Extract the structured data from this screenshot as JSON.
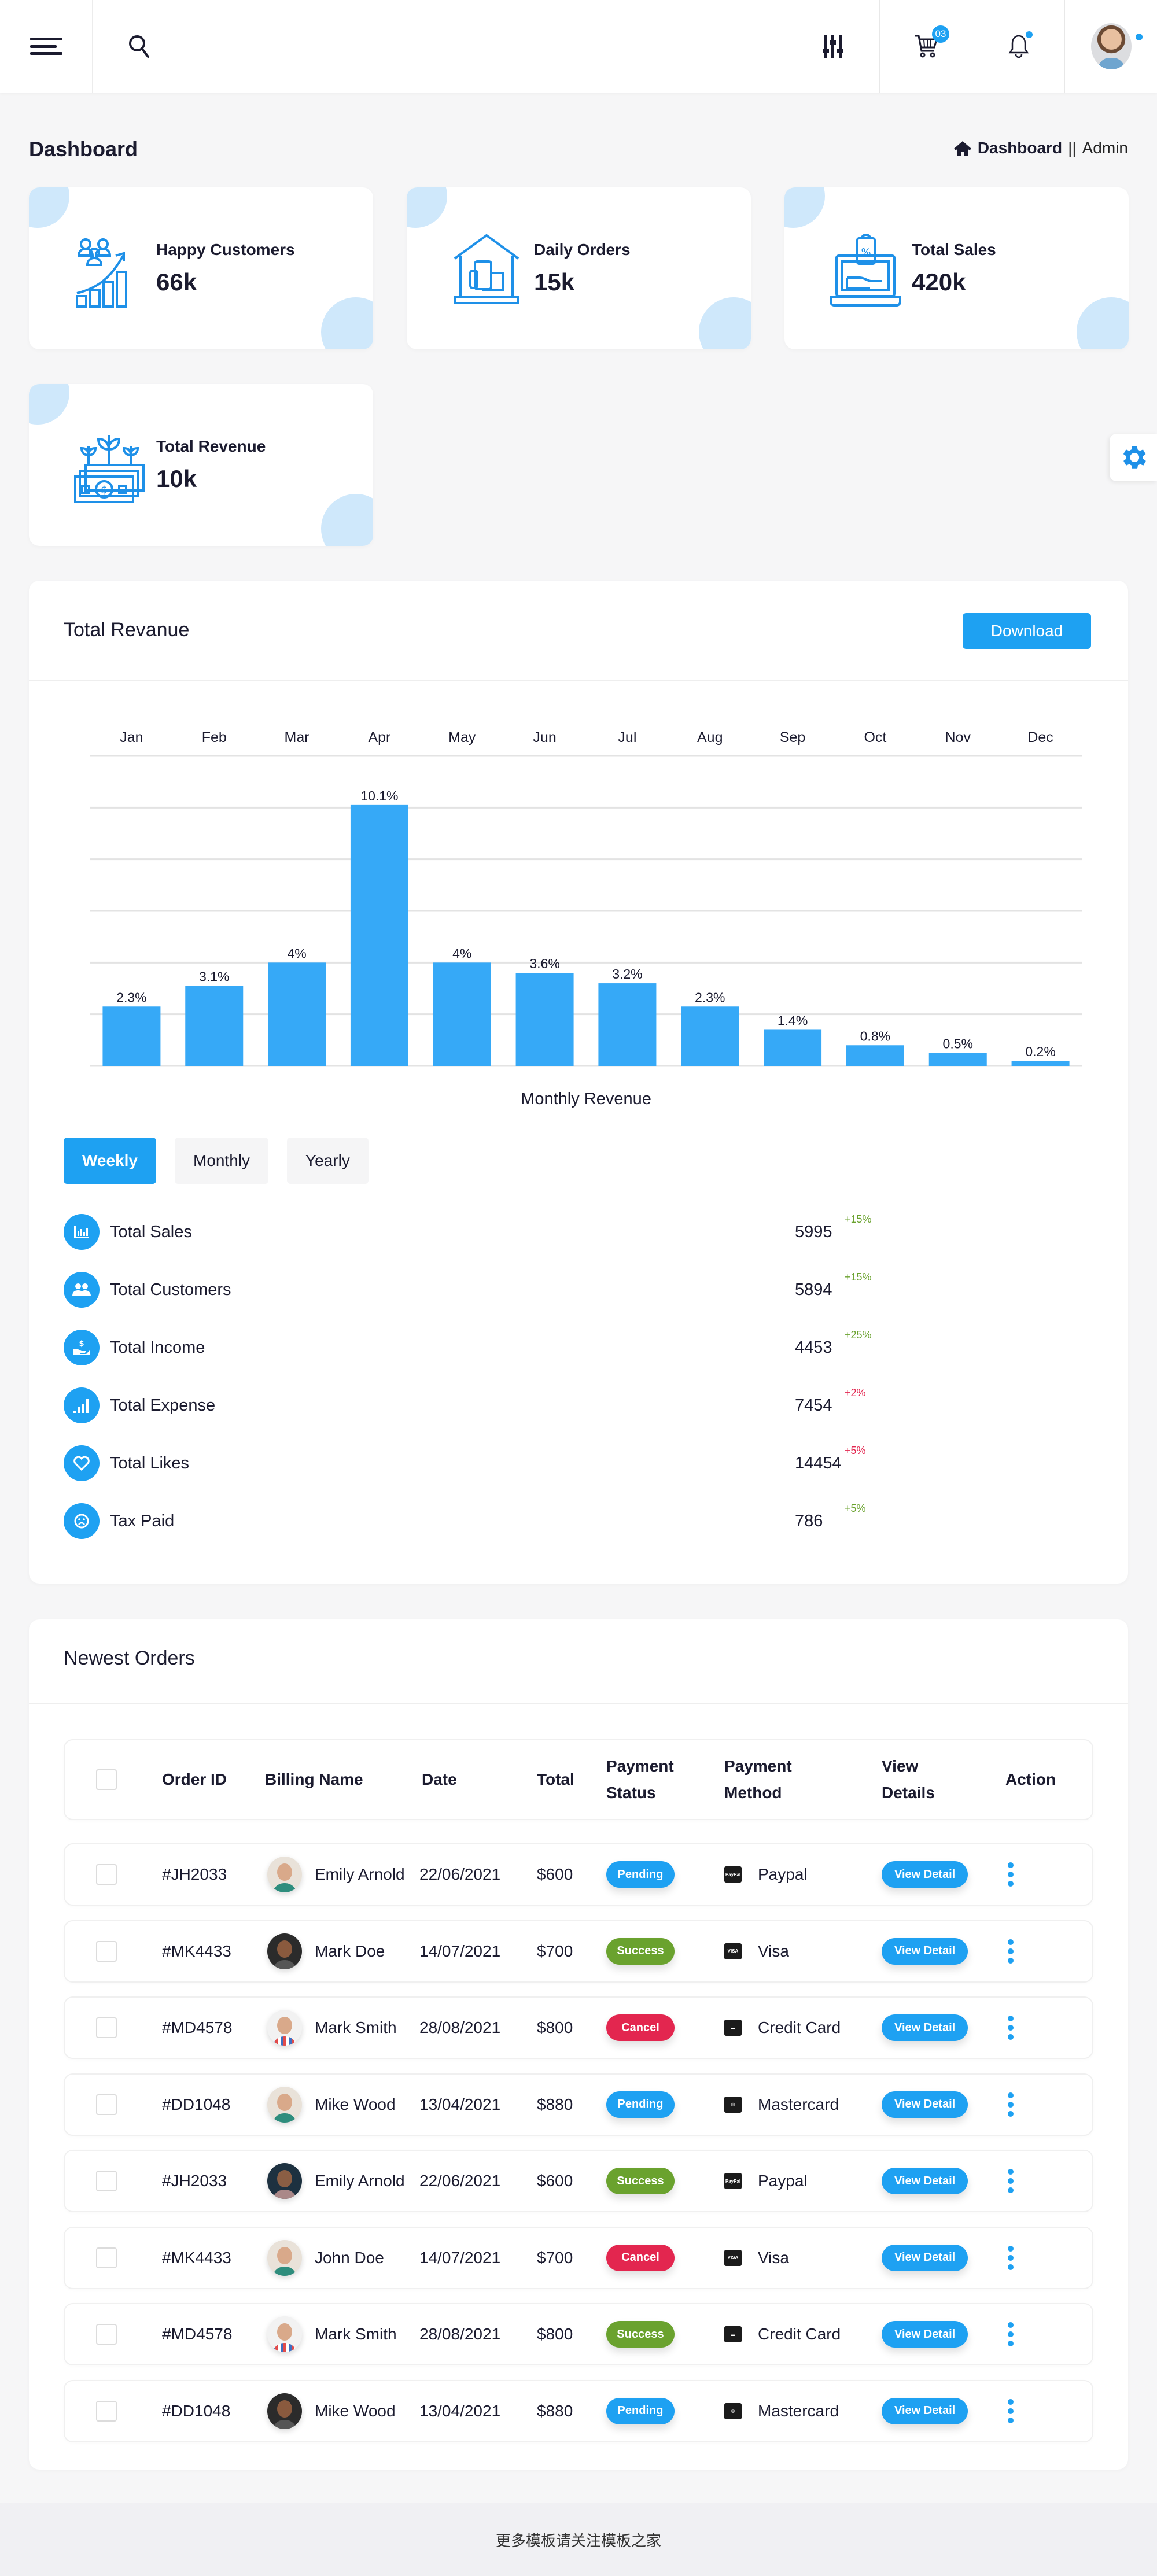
{
  "header": {
    "menu_icon": "hamburger-icon",
    "search_icon": "search-icon",
    "filter_icon": "sliders-icon",
    "cart_icon": "cart-icon",
    "cart_count": "03",
    "notification_icon": "bell-icon",
    "user_avatar": "user-avatar"
  },
  "page": {
    "title": "Dashboard",
    "breadcrumb": {
      "home_icon": "home-icon",
      "home": "Dashboard",
      "separator": "||",
      "current": "Admin"
    }
  },
  "accent_color": "#1ea1f2",
  "stats": [
    {
      "label": "Happy Customers",
      "value": "66k",
      "icon": "customers-growth-icon"
    },
    {
      "label": "Daily Orders",
      "value": "15k",
      "icon": "shop-order-icon"
    },
    {
      "label": "Total Sales",
      "value": "420k",
      "icon": "laptop-sale-icon"
    },
    {
      "label": "Total Revenue",
      "value": "10k",
      "icon": "money-plant-icon"
    }
  ],
  "settings_icon": "gear-icon",
  "revenue": {
    "title": "Total Revanue",
    "download_label": "Download",
    "period_tabs": [
      {
        "label": "Weekly",
        "active": true
      },
      {
        "label": "Monthly",
        "active": false
      },
      {
        "label": "Yearly",
        "active": false
      }
    ],
    "metrics": [
      {
        "label": "Total Sales",
        "value": "5995",
        "change": "+15%",
        "trend": "pos",
        "icon": "bar-chart-icon"
      },
      {
        "label": "Total Customers",
        "value": "5894",
        "change": "+15%",
        "trend": "pos",
        "icon": "users-icon"
      },
      {
        "label": "Total Income",
        "value": "4453",
        "change": "+25%",
        "trend": "pos",
        "icon": "hand-dollar-icon"
      },
      {
        "label": "Total Expense",
        "value": "7454",
        "change": "+2%",
        "trend": "neg",
        "icon": "signal-bars-icon"
      },
      {
        "label": "Total Likes",
        "value": "14454",
        "change": "+5%",
        "trend": "neg",
        "icon": "heart-icon"
      },
      {
        "label": "Tax Paid",
        "value": "786",
        "change": "+5%",
        "trend": "pos",
        "icon": "sad-face-icon"
      }
    ]
  },
  "chart_data": {
    "type": "bar",
    "title": "",
    "xlabel": "Monthly Revenue",
    "ylabel": "",
    "categories": [
      "Jan",
      "Feb",
      "Mar",
      "Apr",
      "May",
      "Jun",
      "Jul",
      "Aug",
      "Sep",
      "Oct",
      "Nov",
      "Dec"
    ],
    "values": [
      2.3,
      3.1,
      4,
      10.1,
      4,
      3.6,
      3.2,
      2.3,
      1.4,
      0.8,
      0.5,
      0.2
    ],
    "data_labels": [
      "2.3%",
      "3.1%",
      "4%",
      "10.1%",
      "4%",
      "3.6%",
      "3.2%",
      "2.3%",
      "1.4%",
      "0.8%",
      "0.5%",
      "0.2%"
    ],
    "ylim": [
      0,
      12
    ],
    "grid_step": 2,
    "grid": true,
    "x_axis_position": "top",
    "bar_color": "#36a9f7"
  },
  "orders": {
    "title": "Newest Orders",
    "columns": [
      "Order ID",
      "Billing Name",
      "Date",
      "Total",
      "Payment Status",
      "Payment Method",
      "View Details",
      "Action"
    ],
    "view_label": "View Detail",
    "rows": [
      {
        "id": "#JH2033",
        "name": "Emily Arnold",
        "date": "22/06/2021",
        "total": "$600",
        "status": "Pending",
        "method": "Paypal",
        "method_icon": "PayPal",
        "avatar": "a"
      },
      {
        "id": "#MK4433",
        "name": "Mark Doe",
        "date": "14/07/2021",
        "total": "$700",
        "status": "Success",
        "method": "Visa",
        "method_icon": "VISA",
        "avatar": "b"
      },
      {
        "id": "#MD4578",
        "name": "Mark Smith",
        "date": "28/08/2021",
        "total": "$800",
        "status": "Cancel",
        "method": "Credit Card",
        "method_icon": "▬",
        "avatar": "c"
      },
      {
        "id": "#DD1048",
        "name": "Mike Wood",
        "date": "13/04/2021",
        "total": "$880",
        "status": "Pending",
        "method": "Mastercard",
        "method_icon": "◎",
        "avatar": "a"
      },
      {
        "id": "#JH2033",
        "name": "Emily Arnold",
        "date": "22/06/2021",
        "total": "$600",
        "status": "Success",
        "method": "Paypal",
        "method_icon": "PayPal",
        "avatar": "d"
      },
      {
        "id": "#MK4433",
        "name": "John Doe",
        "date": "14/07/2021",
        "total": "$700",
        "status": "Cancel",
        "method": "Visa",
        "method_icon": "VISA",
        "avatar": "a"
      },
      {
        "id": "#MD4578",
        "name": "Mark Smith",
        "date": "28/08/2021",
        "total": "$800",
        "status": "Success",
        "method": "Credit Card",
        "method_icon": "▬",
        "avatar": "c"
      },
      {
        "id": "#DD1048",
        "name": "Mike Wood",
        "date": "13/04/2021",
        "total": "$880",
        "status": "Pending",
        "method": "Mastercard",
        "method_icon": "◎",
        "avatar": "b"
      }
    ]
  },
  "footer": {
    "text": "更多模板请关注模板之家"
  }
}
